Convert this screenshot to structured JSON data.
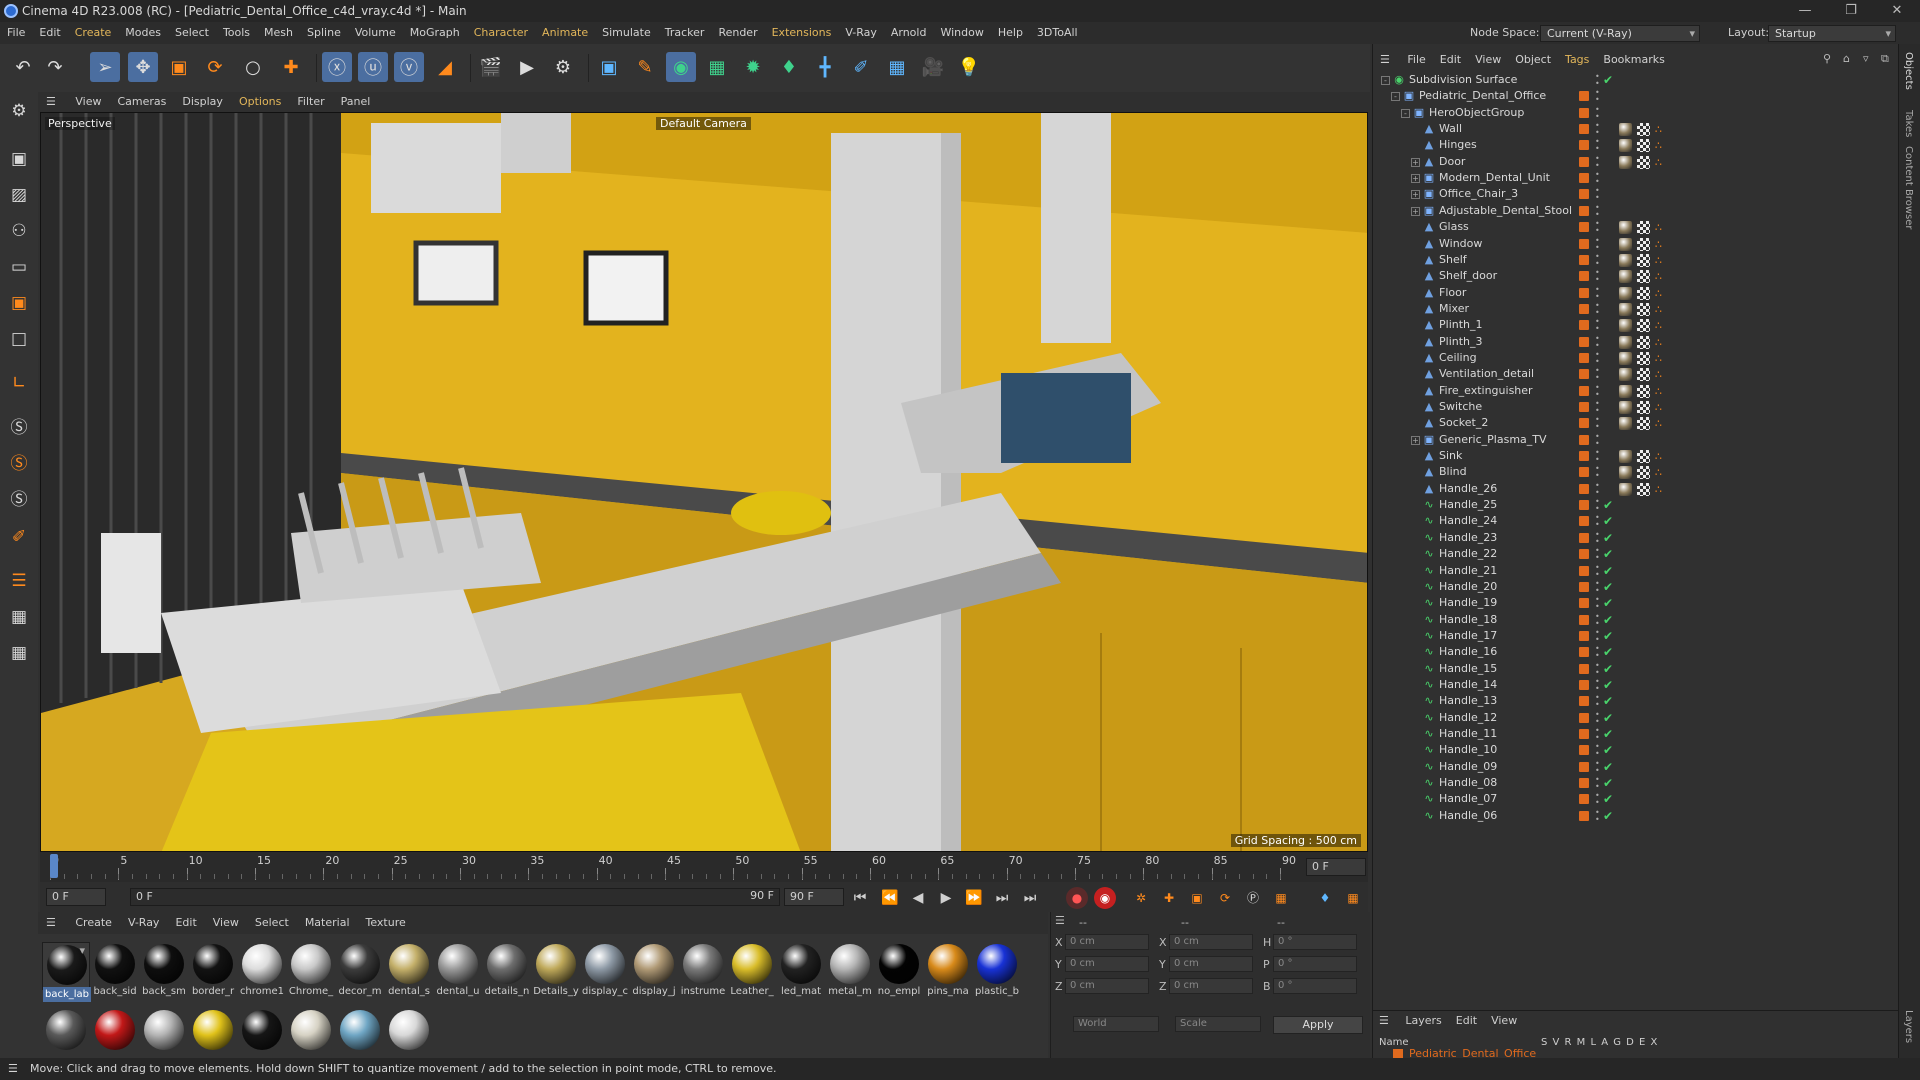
{
  "window": {
    "title": "Cinema 4D R23.008 (RC) - [Pediatric_Dental_Office_c4d_vray.c4d *] - Main"
  },
  "menu": [
    "File",
    "Edit",
    "Create",
    "Modes",
    "Select",
    "Tools",
    "Mesh",
    "Spline",
    "Volume",
    "MoGraph",
    "Character",
    "Animate",
    "Simulate",
    "Tracker",
    "Render",
    "Extensions",
    "V-Ray",
    "Arnold",
    "Window",
    "Help",
    "3DToAll"
  ],
  "nodespace": {
    "label": "Node Space:",
    "value": "Current (V-Ray)"
  },
  "layout": {
    "label": "Layout:",
    "value": "Startup"
  },
  "viewport": {
    "menu": [
      "View",
      "Cameras",
      "Display",
      "Options",
      "Filter",
      "Panel"
    ],
    "label": "Perspective",
    "camera": "Default Camera",
    "grid_spacing": "Grid Spacing : 500 cm"
  },
  "timeline": {
    "ticks": [
      "0",
      "5",
      "10",
      "15",
      "20",
      "25",
      "30",
      "35",
      "40",
      "45",
      "50",
      "55",
      "60",
      "65",
      "70",
      "75",
      "80",
      "85",
      "90"
    ],
    "current_frame": "0 F"
  },
  "transport": {
    "start": "0 F",
    "current": "0 F",
    "end": "90 F",
    "end2": "90 F"
  },
  "materials": {
    "menu": [
      "Create",
      "V-Ray",
      "Edit",
      "View",
      "Select",
      "Material",
      "Texture"
    ],
    "row1": [
      {
        "name": "back_lab",
        "color": "#1a1a1a"
      },
      {
        "name": "back_sid",
        "color": "#111111"
      },
      {
        "name": "back_sm",
        "color": "#0e0e0e"
      },
      {
        "name": "border_r",
        "color": "#131313"
      },
      {
        "name": "chrome1",
        "color": "#dcdcdc"
      },
      {
        "name": "Chrome_",
        "color": "#c8c8c8"
      },
      {
        "name": "decor_m",
        "color": "#3c3c3c"
      },
      {
        "name": "dental_s",
        "color": "#c4b06a"
      },
      {
        "name": "dental_u",
        "color": "#9a9a9a"
      },
      {
        "name": "details_n",
        "color": "#6e6e6e"
      },
      {
        "name": "Details_y",
        "color": "#bfa95a"
      },
      {
        "name": "display_c",
        "color": "#8e9aa6"
      },
      {
        "name": "display_j",
        "color": "#b09a76"
      },
      {
        "name": "instrume",
        "color": "#7a7a7a"
      },
      {
        "name": "Leather_",
        "color": "#d9bd2a"
      },
      {
        "name": "led_mat",
        "color": "#222222"
      },
      {
        "name": "metal_m",
        "color": "#b5b5b5"
      },
      {
        "name": "no_empl",
        "color": "#030303"
      },
      {
        "name": "pins_ma",
        "color": "#d88a1a"
      },
      {
        "name": "plastic_b",
        "color": "#1832d6"
      }
    ],
    "row2": [
      {
        "color": "#5a5a5a"
      },
      {
        "color": "#c21818"
      },
      {
        "color": "#b4b4b4"
      },
      {
        "color": "#e0c21a"
      },
      {
        "color": "#161616"
      },
      {
        "color": "#d6d2c4"
      },
      {
        "color": "#6fa6c4"
      },
      {
        "color": "#d8d8d8"
      }
    ]
  },
  "attributes": {
    "header1": "--",
    "header2": "--",
    "header3": "--",
    "rows": [
      {
        "l1": "X",
        "v1": "0 cm",
        "l2": "X",
        "v2": "0 cm",
        "l3": "H",
        "v3": "0 °"
      },
      {
        "l1": "Y",
        "v1": "0 cm",
        "l2": "Y",
        "v2": "0 cm",
        "l3": "P",
        "v3": "0 °"
      },
      {
        "l1": "Z",
        "v1": "0 cm",
        "l2": "Z",
        "v2": "0 cm",
        "l3": "B",
        "v3": "0 °"
      }
    ],
    "coord_mode": "World",
    "scale_mode": "Scale",
    "apply": "Apply"
  },
  "objects": {
    "menu": [
      "File",
      "Edit",
      "View",
      "Object",
      "Tags",
      "Bookmarks"
    ],
    "items": [
      {
        "name": "Subdivision Surface",
        "depth": 0,
        "icon": "subdiv",
        "tags": "check",
        "exp": "-"
      },
      {
        "name": "Pediatric_Dental_Office",
        "depth": 1,
        "icon": "null",
        "tags": "none",
        "exp": "-"
      },
      {
        "name": "HeroObjectGroup",
        "depth": 2,
        "icon": "null",
        "tags": "none",
        "exp": "-"
      },
      {
        "name": "Wall",
        "depth": 3,
        "icon": "poly",
        "tags": "mat",
        "exp": ""
      },
      {
        "name": "Hinges",
        "depth": 3,
        "icon": "poly",
        "tags": "mat",
        "exp": ""
      },
      {
        "name": "Door",
        "depth": 3,
        "icon": "poly",
        "tags": "mat",
        "exp": "+"
      },
      {
        "name": "Modern_Dental_Unit",
        "depth": 3,
        "icon": "null",
        "tags": "none",
        "exp": "+"
      },
      {
        "name": "Office_Chair_3",
        "depth": 3,
        "icon": "null",
        "tags": "none",
        "exp": "+"
      },
      {
        "name": "Adjustable_Dental_Stool",
        "depth": 3,
        "icon": "null",
        "tags": "none",
        "exp": "+"
      },
      {
        "name": "Glass",
        "depth": 3,
        "icon": "poly",
        "tags": "mat",
        "exp": ""
      },
      {
        "name": "Window",
        "depth": 3,
        "icon": "poly",
        "tags": "mat",
        "exp": ""
      },
      {
        "name": "Shelf",
        "depth": 3,
        "icon": "poly",
        "tags": "mat",
        "exp": ""
      },
      {
        "name": "Shelf_door",
        "depth": 3,
        "icon": "poly",
        "tags": "mat",
        "exp": ""
      },
      {
        "name": "Floor",
        "depth": 3,
        "icon": "poly",
        "tags": "mat",
        "exp": ""
      },
      {
        "name": "Mixer",
        "depth": 3,
        "icon": "poly",
        "tags": "mat",
        "exp": ""
      },
      {
        "name": "Plinth_1",
        "depth": 3,
        "icon": "poly",
        "tags": "mat",
        "exp": ""
      },
      {
        "name": "Plinth_3",
        "depth": 3,
        "icon": "poly",
        "tags": "mat",
        "exp": ""
      },
      {
        "name": "Ceiling",
        "depth": 3,
        "icon": "poly",
        "tags": "mat",
        "exp": ""
      },
      {
        "name": "Ventilation_detail",
        "depth": 3,
        "icon": "poly",
        "tags": "mat",
        "exp": ""
      },
      {
        "name": "Fire_extinguisher",
        "depth": 3,
        "icon": "poly",
        "tags": "mat",
        "exp": ""
      },
      {
        "name": "Switche",
        "depth": 3,
        "icon": "poly",
        "tags": "mat",
        "exp": ""
      },
      {
        "name": "Socket_2",
        "depth": 3,
        "icon": "poly",
        "tags": "mat",
        "exp": ""
      },
      {
        "name": "Generic_Plasma_TV",
        "depth": 3,
        "icon": "null",
        "tags": "none",
        "exp": "+"
      },
      {
        "name": "Sink",
        "depth": 3,
        "icon": "poly",
        "tags": "mat",
        "exp": ""
      },
      {
        "name": "Blind",
        "depth": 3,
        "icon": "poly",
        "tags": "mat",
        "exp": ""
      },
      {
        "name": "Handle_26",
        "depth": 3,
        "icon": "poly",
        "tags": "mat",
        "exp": ""
      },
      {
        "name": "Handle_25",
        "depth": 3,
        "icon": "spline",
        "tags": "check",
        "exp": ""
      },
      {
        "name": "Handle_24",
        "depth": 3,
        "icon": "spline",
        "tags": "check",
        "exp": ""
      },
      {
        "name": "Handle_23",
        "depth": 3,
        "icon": "spline",
        "tags": "check",
        "exp": ""
      },
      {
        "name": "Handle_22",
        "depth": 3,
        "icon": "spline",
        "tags": "check",
        "exp": ""
      },
      {
        "name": "Handle_21",
        "depth": 3,
        "icon": "spline",
        "tags": "check",
        "exp": ""
      },
      {
        "name": "Handle_20",
        "depth": 3,
        "icon": "spline",
        "tags": "check",
        "exp": ""
      },
      {
        "name": "Handle_19",
        "depth": 3,
        "icon": "spline",
        "tags": "check",
        "exp": ""
      },
      {
        "name": "Handle_18",
        "depth": 3,
        "icon": "spline",
        "tags": "check",
        "exp": ""
      },
      {
        "name": "Handle_17",
        "depth": 3,
        "icon": "spline",
        "tags": "check",
        "exp": ""
      },
      {
        "name": "Handle_16",
        "depth": 3,
        "icon": "spline",
        "tags": "check",
        "exp": ""
      },
      {
        "name": "Handle_15",
        "depth": 3,
        "icon": "spline",
        "tags": "check",
        "exp": ""
      },
      {
        "name": "Handle_14",
        "depth": 3,
        "icon": "spline",
        "tags": "check",
        "exp": ""
      },
      {
        "name": "Handle_13",
        "depth": 3,
        "icon": "spline",
        "tags": "check",
        "exp": ""
      },
      {
        "name": "Handle_12",
        "depth": 3,
        "icon": "spline",
        "tags": "check",
        "exp": ""
      },
      {
        "name": "Handle_11",
        "depth": 3,
        "icon": "spline",
        "tags": "check",
        "exp": ""
      },
      {
        "name": "Handle_10",
        "depth": 3,
        "icon": "spline",
        "tags": "check",
        "exp": ""
      },
      {
        "name": "Handle_09",
        "depth": 3,
        "icon": "spline",
        "tags": "check",
        "exp": ""
      },
      {
        "name": "Handle_08",
        "depth": 3,
        "icon": "spline",
        "tags": "check",
        "exp": ""
      },
      {
        "name": "Handle_07",
        "depth": 3,
        "icon": "spline",
        "tags": "check",
        "exp": ""
      },
      {
        "name": "Handle_06",
        "depth": 3,
        "icon": "spline",
        "tags": "check",
        "exp": ""
      }
    ]
  },
  "right_tabs": [
    "Objects",
    "Takes",
    "Content Browser",
    "Layers"
  ],
  "layers": {
    "menu": [
      "Layers",
      "Edit",
      "View"
    ],
    "col_name": "Name",
    "col_flags": "S V R M L A G D E X",
    "item": "Pediatric_Dental_Office"
  },
  "status": "Move: Click and drag to move elements. Hold down SHIFT to quantize movement / add to the selection in point mode, CTRL to remove."
}
